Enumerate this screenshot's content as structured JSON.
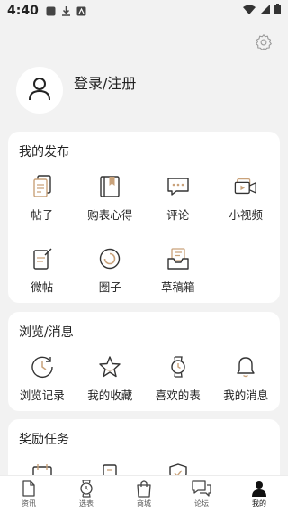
{
  "status_bar": {
    "time": "4:40"
  },
  "profile": {
    "login_label": "登录/注册"
  },
  "my_posts": {
    "title": "我的发布",
    "row1": [
      {
        "label": "帖子",
        "icon": "document-icon"
      },
      {
        "label": "购表心得",
        "icon": "bookmark-book-icon"
      },
      {
        "label": "评论",
        "icon": "comment-icon"
      },
      {
        "label": "小视频",
        "icon": "video-icon"
      }
    ],
    "row2": [
      {
        "label": "微帖",
        "icon": "micro-post-icon"
      },
      {
        "label": "圈子",
        "icon": "circle-icon"
      },
      {
        "label": "草稿箱",
        "icon": "draft-box-icon"
      }
    ]
  },
  "browse": {
    "title": "浏览/消息",
    "items": [
      {
        "label": "浏览记录",
        "icon": "clock-icon"
      },
      {
        "label": "我的收藏",
        "icon": "star-icon"
      },
      {
        "label": "喜欢的表",
        "icon": "watch-icon"
      },
      {
        "label": "我的消息",
        "icon": "bell-icon"
      }
    ]
  },
  "rewards": {
    "title": "奖励任务"
  },
  "bottom_nav": [
    {
      "label": "资讯",
      "icon": "news-icon"
    },
    {
      "label": "选表",
      "icon": "watch-icon"
    },
    {
      "label": "商城",
      "icon": "shopping-bag-icon"
    },
    {
      "label": "论坛",
      "icon": "forum-icon"
    },
    {
      "label": "我的",
      "icon": "person-icon",
      "active": true
    }
  ],
  "colors": {
    "accent": "#c9a27a",
    "icon_stroke": "#333333",
    "background": "#f2f2f2"
  }
}
